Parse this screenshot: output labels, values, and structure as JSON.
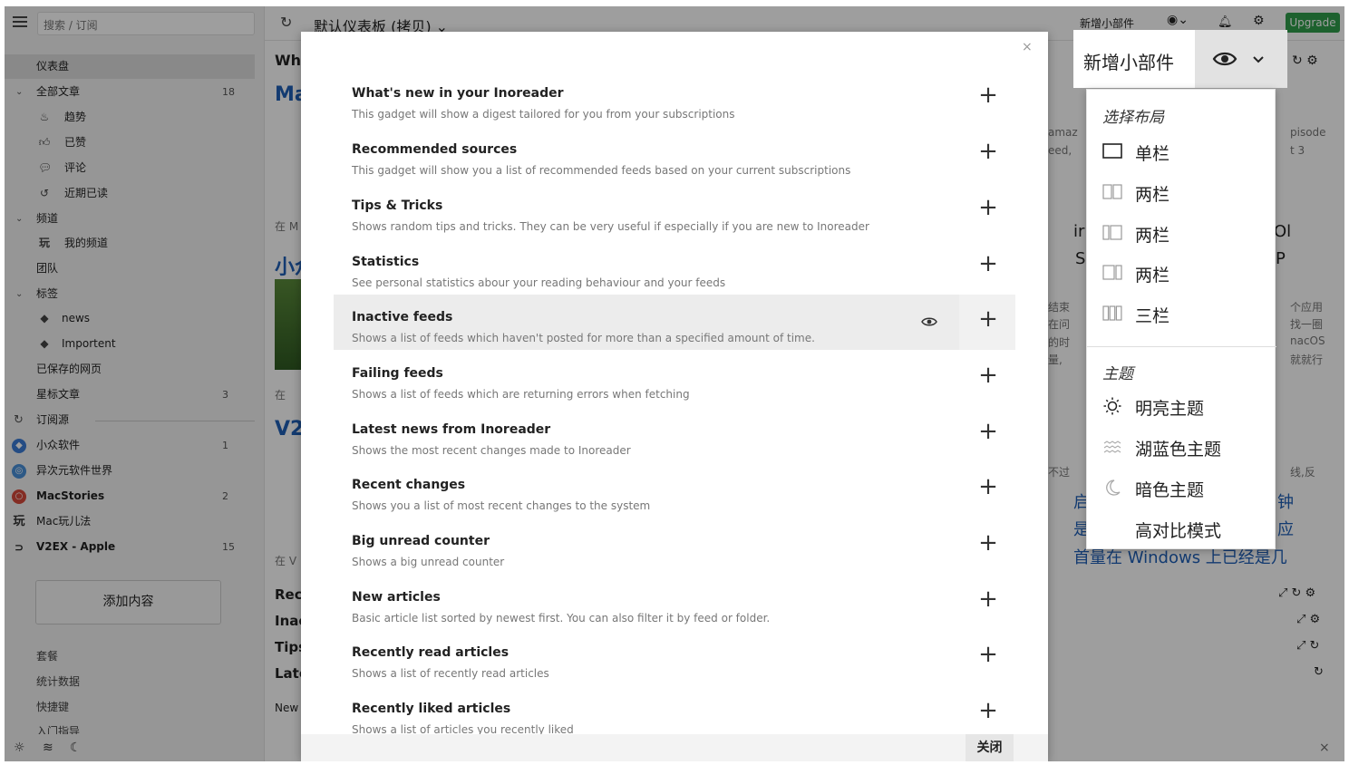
{
  "sidebar": {
    "search_placeholder": "搜索 / 订阅",
    "dashboard": "仪表盘",
    "all_articles": "全部文章",
    "all_articles_count": "18",
    "trending": "趋势",
    "liked": "已赞",
    "comments": "评论",
    "recently_read": "近期已读",
    "channels": "频道",
    "my_channel": "我的频道",
    "team": "团队",
    "tags": "标签",
    "tag_news": "news",
    "tag_importent": "Importent",
    "saved_pages": "已保存的网页",
    "starred": "星标文章",
    "starred_count": "3",
    "subscriptions": "订阅源",
    "feeds": [
      {
        "name": "小众软件",
        "count": "1",
        "color": "#3a7bd5"
      },
      {
        "name": "异次元软件世界",
        "count": "",
        "color": "#4a90d9"
      },
      {
        "name": "MacStories",
        "count": "2",
        "color": "#d64a3a"
      },
      {
        "name": "Mac玩儿法",
        "count": "",
        "color": "#333333"
      },
      {
        "name": "V2EX - Apple",
        "count": "15",
        "color": "#222222"
      }
    ],
    "add_content": "添加内容",
    "footer": [
      "套餐",
      "统计数据",
      "快捷键",
      "入门指导"
    ]
  },
  "topbar": {
    "dashboard_title": "默认仪表板 (拷贝)",
    "add_widget": "新增小部件",
    "upgrade": "Upgrade"
  },
  "background": {
    "col1": [
      "Wha",
      "Ma",
      "在 M",
      "小众",
      "在",
      "V2",
      "在 V",
      "Rec",
      "Inac",
      "Tips",
      "Late",
      "New"
    ],
    "right_snips": [
      "amaz",
      "eed,",
      "pisode",
      "t 3",
      "ir",
      "S",
      "Ol",
      "P",
      "结束",
      "在问",
      "的时",
      "量,",
      "个应用",
      "找一圈",
      "nacOS",
      "就就行",
      "不过",
      "启",
      "是",
      "线,反",
      "钟",
      "应"
    ],
    "bottom_snip": "首量在 Windows 上已经是几"
  },
  "modal": {
    "close_label": "关闭",
    "gadgets": [
      {
        "title": "What's new in your Inoreader",
        "desc": "This gadget will show a digest tailored for you from your subscriptions"
      },
      {
        "title": "Recommended sources",
        "desc": "This gadget will show you a list of recommended feeds based on your current subscriptions"
      },
      {
        "title": "Tips & Tricks",
        "desc": "Shows random tips and tricks. They can be very useful if especially if you are new to Inoreader"
      },
      {
        "title": "Statistics",
        "desc": "See personal statistics abour your reading behaviour and your feeds"
      },
      {
        "title": "Inactive feeds",
        "desc": "Shows a list of feeds which haven't posted for more than a specified amount of time."
      },
      {
        "title": "Failing feeds",
        "desc": "Shows a list of feeds which are returning errors when fetching"
      },
      {
        "title": "Latest news from Inoreader",
        "desc": "Shows the most recent changes made to Inoreader"
      },
      {
        "title": "Recent changes",
        "desc": "Shows you a list of most recent changes to the system"
      },
      {
        "title": "Big unread counter",
        "desc": "Shows a big unread counter"
      },
      {
        "title": "New articles",
        "desc": "Basic article list sorted by newest first. You can also filter it by feed or folder."
      },
      {
        "title": "Recently read articles",
        "desc": "Shows a list of recently read articles"
      },
      {
        "title": "Recently liked articles",
        "desc": "Shows a list of articles you recently liked"
      }
    ]
  },
  "new_widget_panel": {
    "title": "新增小部件"
  },
  "dropdown": {
    "layout_section": "选择布局",
    "layouts": [
      "单栏",
      "两栏",
      "两栏",
      "两栏",
      "三栏"
    ],
    "theme_section": "主题",
    "themes": [
      "明亮主题",
      "湖蓝色主题",
      "暗色主题",
      "高对比模式"
    ]
  }
}
